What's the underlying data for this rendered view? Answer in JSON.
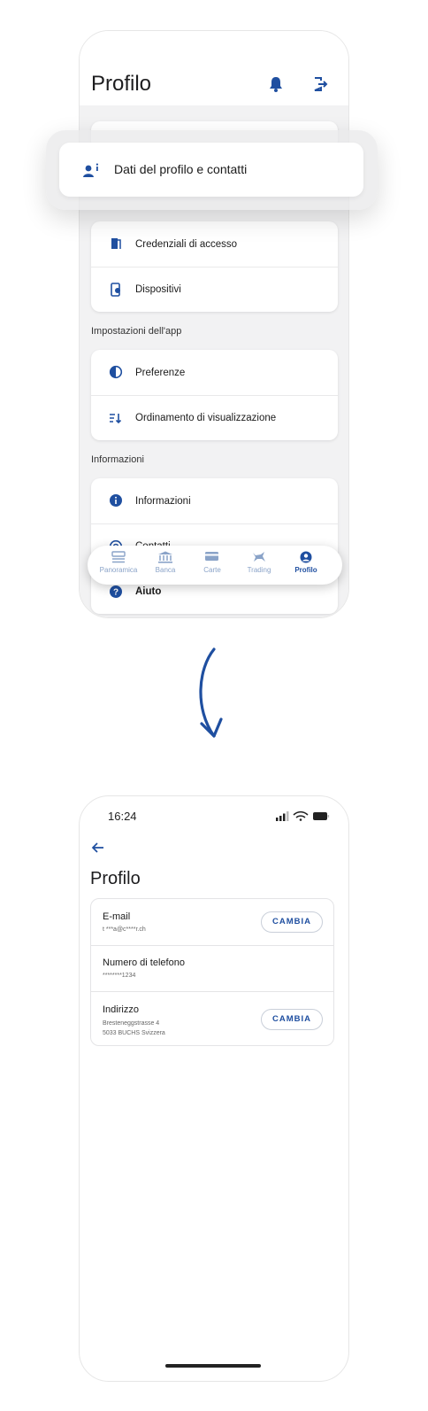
{
  "colors": {
    "accent": "#1f4fa0",
    "nav_inactive": "#8aa3c8",
    "background": "#f2f2f3"
  },
  "menu_screen": {
    "title": "Profilo",
    "header_icons": [
      "bell-icon",
      "logout-icon"
    ],
    "highlighted_item": {
      "label": "Dati del profilo e contatti",
      "icon": "profile-info-icon"
    },
    "security_items": [
      {
        "label": "Credenziali di accesso",
        "icon": "door-icon"
      },
      {
        "label": "Dispositivi",
        "icon": "device-settings-icon"
      }
    ],
    "app_settings": {
      "heading": "Impostazioni dell'app",
      "items": [
        {
          "label": "Preferenze",
          "icon": "contrast-icon"
        },
        {
          "label": "Ordinamento di visualizzazione",
          "icon": "sort-icon"
        }
      ]
    },
    "info": {
      "heading": "Informazioni",
      "items": [
        {
          "label": "Informazioni",
          "icon": "info-icon"
        },
        {
          "label": "Contatti",
          "icon": "at-icon"
        },
        {
          "label": "Aiuto",
          "icon": "help-icon"
        }
      ]
    },
    "nav": [
      {
        "label": "Panoramica",
        "icon": "overview-icon"
      },
      {
        "label": "Banca",
        "icon": "bank-icon"
      },
      {
        "label": "Carte",
        "icon": "card-icon"
      },
      {
        "label": "Trading",
        "icon": "bull-icon"
      },
      {
        "label": "Profilo",
        "icon": "profile-icon",
        "active": true
      }
    ]
  },
  "detail_screen": {
    "status_time": "16:24",
    "title": "Profilo",
    "rows": [
      {
        "label": "E-mail",
        "value": "t ***a@c****r.ch",
        "action": "CAMBIA"
      },
      {
        "label": "Numero di telefono",
        "value": "********1234"
      },
      {
        "label": "Indirizzo",
        "value_lines": [
          "Bresteneggstrasse 4",
          "5033 BUCHS Svizzera"
        ],
        "action": "CAMBIA"
      }
    ]
  }
}
